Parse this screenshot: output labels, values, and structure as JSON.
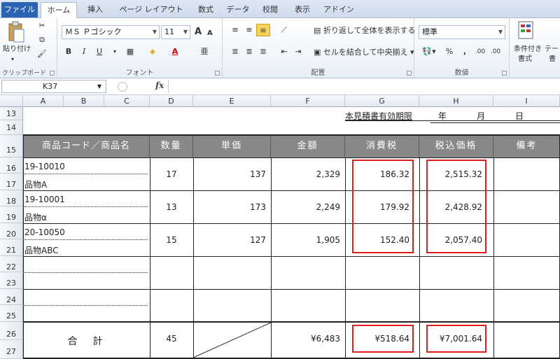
{
  "ribbon_tabs": [
    "ファイル",
    "ホーム",
    "挿入",
    "ページ レイアウト",
    "数式",
    "データ",
    "校閲",
    "表示",
    "アドイン"
  ],
  "clipboard": {
    "paste": "貼り付け",
    "label": "クリップボード"
  },
  "font": {
    "name": "ＭＳ Ｐゴシック",
    "size": "11",
    "label": "フォント",
    "bold": "B",
    "italic": "I",
    "underline": "U",
    "grow": "A",
    "shrink": "A"
  },
  "align": {
    "wrap": "折り返して全体を表示する",
    "merge": "セルを結合して中央揃え",
    "label": "配置"
  },
  "number": {
    "format": "標準",
    "label": "数値",
    "percent": "%",
    "comma": ",",
    "inc": ".00",
    "dec": ".00"
  },
  "styles": {
    "cond": "条件付き",
    "cond2": "書式",
    "table": "テー",
    "table2": "書"
  },
  "namebox": "K37",
  "fx": "fx",
  "columns": [
    "A",
    "B",
    "C",
    "D",
    "E",
    "F",
    "G",
    "H",
    "I"
  ],
  "rows": [
    "13",
    "14",
    "15",
    "16",
    "17",
    "18",
    "19",
    "20",
    "21",
    "22",
    "23",
    "24",
    "25",
    "26",
    "27"
  ],
  "validity": {
    "label": "本見積書有効期限",
    "year": "年",
    "month": "月",
    "day": "日"
  },
  "headers": [
    "商品コード／商品名",
    "数量",
    "単価",
    "金額",
    "消費税",
    "税込価格",
    "備考"
  ],
  "items": [
    {
      "code": "19-10010",
      "name": "品物A",
      "qty": "17",
      "price": "137",
      "amount": "2,329",
      "tax": "186.32",
      "total": "2,515.32"
    },
    {
      "code": "19-10001",
      "name": "品物α",
      "qty": "13",
      "price": "173",
      "amount": "2,249",
      "tax": "179.92",
      "total": "2,428.92"
    },
    {
      "code": "20-10050",
      "name": "品物ABC",
      "qty": "15",
      "price": "127",
      "amount": "1,905",
      "tax": "152.40",
      "total": "2,057.40"
    }
  ],
  "totals": {
    "label": "合　計",
    "qty": "45",
    "amount": "¥6,483",
    "tax": "¥518.64",
    "total": "¥7,001.64"
  },
  "colors": {
    "header_bg": "#888888",
    "highlight": "#e01c1c",
    "file_tab": "#2a62b4"
  }
}
